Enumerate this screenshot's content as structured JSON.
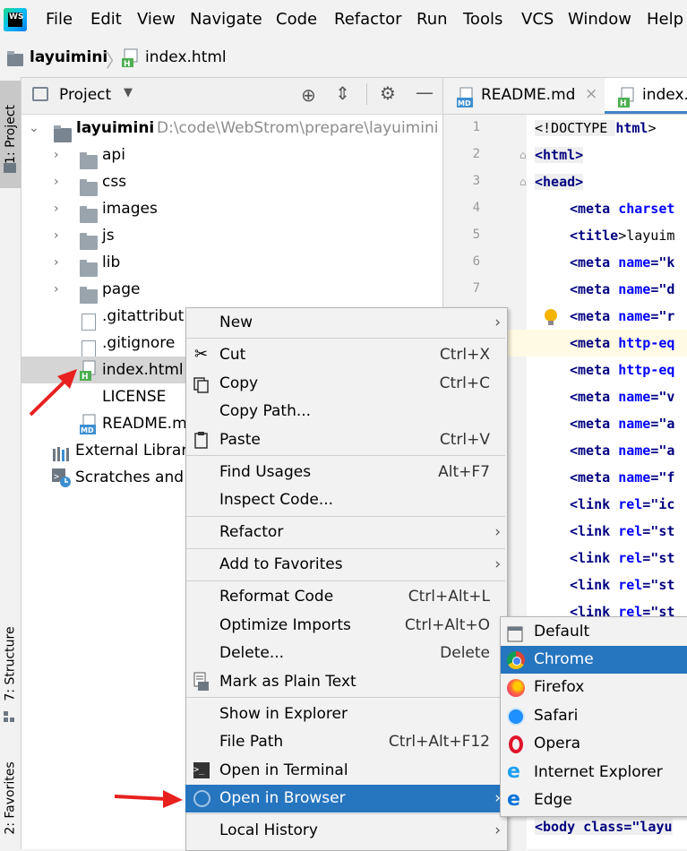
{
  "menubar": {
    "logo_text": "WS",
    "items": [
      "File",
      "Edit",
      "View",
      "Navigate",
      "Code",
      "Refactor",
      "Run",
      "Tools",
      "VCS",
      "Window",
      "Help"
    ]
  },
  "breadcrumb": {
    "project": "layuimini",
    "file": "index.html"
  },
  "left_stripe": {
    "project_tab": "1: Project",
    "structure_tab": "7: Structure",
    "favorites_tab": "2: Favorites"
  },
  "project_panel": {
    "title": "Project",
    "root": {
      "name": "layuimini",
      "path": "D:\\code\\WebStrom\\prepare\\layuimini"
    },
    "folders": [
      "api",
      "css",
      "images",
      "js",
      "lib",
      "page"
    ],
    "files": [
      ".gitattribut",
      ".gitignore",
      "index.html",
      "LICENSE",
      "README.m"
    ],
    "external": "External Librar",
    "scratches": "Scratches and"
  },
  "editor": {
    "tabs": [
      {
        "label": "README.md"
      },
      {
        "label": "index."
      }
    ],
    "line_numbers": [
      "1",
      "2",
      "3",
      "4",
      "5",
      "6",
      "7"
    ],
    "lines": [
      {
        "tag": "<!DOCTYPE ",
        "kw": "html",
        "rest": ">"
      },
      {
        "tag": "<html",
        "kw": "",
        "rest": ">"
      },
      {
        "tag": "<head",
        "kw": "",
        "rest": ">"
      },
      {
        "tag": "<meta ",
        "kw": "charset",
        "rest": ""
      },
      {
        "tag": "<title",
        "kw": "",
        "rest": ">layuim"
      },
      {
        "tag": "<meta ",
        "kw": "name",
        "rest": "=\"k"
      },
      {
        "tag": "<meta ",
        "kw": "name",
        "rest": "=\"d"
      },
      {
        "tag": "<meta ",
        "kw": "name",
        "rest": "=\"r"
      },
      {
        "tag": "<meta ",
        "kw": "http-eq",
        "rest": ""
      },
      {
        "tag": "<meta ",
        "kw": "http-eq",
        "rest": ""
      },
      {
        "tag": "<meta ",
        "kw": "name",
        "rest": "=\"v"
      },
      {
        "tag": "<meta ",
        "kw": "name",
        "rest": "=\"a"
      },
      {
        "tag": "<meta ",
        "kw": "name",
        "rest": "=\"a"
      },
      {
        "tag": "<meta ",
        "kw": "name",
        "rest": "=\"f"
      },
      {
        "tag": "<link ",
        "kw": "rel",
        "rest": "=\"ic"
      },
      {
        "tag": "<link ",
        "kw": "rel",
        "rest": "=\"st"
      },
      {
        "tag": "<link ",
        "kw": "rel",
        "rest": "=\"st"
      },
      {
        "tag": "<link ",
        "kw": "rel",
        "rest": "=\"st"
      },
      {
        "tag": "<link ",
        "kw": "rel",
        "rest": "=\"st"
      }
    ],
    "body_line": "<body class=\"layu"
  },
  "context_menu": {
    "items": [
      {
        "label": "New",
        "shortcut": "",
        "submenu": true
      },
      {
        "label": "Cut",
        "shortcut": "Ctrl+X"
      },
      {
        "label": "Copy",
        "shortcut": "Ctrl+C"
      },
      {
        "label": "Copy Path...",
        "shortcut": ""
      },
      {
        "label": "Paste",
        "shortcut": "Ctrl+V"
      },
      {
        "label": "Find Usages",
        "shortcut": "Alt+F7"
      },
      {
        "label": "Inspect Code...",
        "shortcut": ""
      },
      {
        "label": "Refactor",
        "shortcut": "",
        "submenu": true
      },
      {
        "label": "Add to Favorites",
        "shortcut": "",
        "submenu": true
      },
      {
        "label": "Reformat Code",
        "shortcut": "Ctrl+Alt+L"
      },
      {
        "label": "Optimize Imports",
        "shortcut": "Ctrl+Alt+O"
      },
      {
        "label": "Delete...",
        "shortcut": "Delete"
      },
      {
        "label": "Mark as Plain Text",
        "shortcut": ""
      },
      {
        "label": "Show in Explorer",
        "shortcut": ""
      },
      {
        "label": "File Path",
        "shortcut": "Ctrl+Alt+F12"
      },
      {
        "label": "Open in Terminal",
        "shortcut": ""
      },
      {
        "label": "Open in Browser",
        "shortcut": "",
        "submenu": true
      },
      {
        "label": "Local History",
        "shortcut": "",
        "submenu": true
      }
    ]
  },
  "browser_submenu": {
    "items": [
      "Default",
      "Chrome",
      "Firefox",
      "Safari",
      "Opera",
      "Internet Explorer",
      "Edge"
    ],
    "selected": "Chrome"
  },
  "colors": {
    "selection": "#2675bf",
    "tag": "#000080",
    "attr": "#0000ff",
    "arrow": "#e8201f"
  }
}
